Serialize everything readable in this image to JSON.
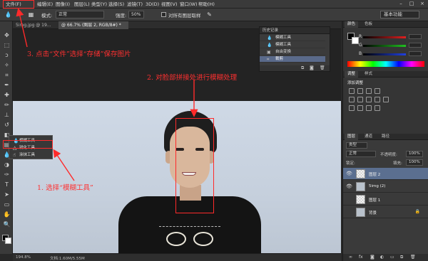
{
  "menubar": {
    "items": [
      "文件(F)",
      "编辑(E)",
      "图像(I)",
      "图层(L)",
      "类型(Y)",
      "选择(S)",
      "滤镜(T)",
      "3D(D)",
      "视图(V)",
      "窗口(W)",
      "帮助(H)"
    ],
    "window_controls": [
      "–",
      "□",
      "×"
    ]
  },
  "options": {
    "mode_label": "模式:",
    "mode_value": "正常",
    "strength_label": "强度:",
    "strength_value": "50%",
    "sample_all_label": "对所有图层取样",
    "workspace": "基本功能"
  },
  "doc_tabs": [
    {
      "label": "5img.jpg @ 19..."
    },
    {
      "label": "@ 66.7% (图层 2, RGB/8#) *"
    }
  ],
  "flyout": {
    "items": [
      {
        "icon": "blur-icon",
        "label": "模糊工具",
        "shortcut": ""
      },
      {
        "icon": "sharpen-icon",
        "label": "锐化工具",
        "shortcut": ""
      },
      {
        "icon": "smudge-icon",
        "label": "涂抹工具",
        "shortcut": ""
      }
    ]
  },
  "annotations": {
    "step1": "1. 选择“模糊工具”",
    "step2": "2. 对脸部拼接处进行模糊处理",
    "step3": "3. 点击“文件”选择“存储”保存图片"
  },
  "history": {
    "title": "历史记录",
    "items": [
      {
        "icon": "drop-icon",
        "label": "模糊工具"
      },
      {
        "icon": "drop-icon",
        "label": "模糊工具"
      },
      {
        "icon": "transform-icon",
        "label": "自由变换"
      },
      {
        "icon": "crop-icon",
        "label": "裁剪"
      }
    ]
  },
  "statusbar": {
    "zoom": "194.8%",
    "doc": "文档:1.60M/5.55M"
  },
  "dock": {
    "color_tabs": [
      "颜色",
      "色板"
    ],
    "slider_labels": [
      "R",
      "G",
      "B"
    ],
    "adjust_tabs": [
      "调整",
      "样式"
    ],
    "adjust_title": "添加调整",
    "layers_tabs": [
      "图层",
      "通道",
      "路径"
    ],
    "kind_label": "类型",
    "blend_mode": "正常",
    "opacity_label": "不透明度:",
    "opacity_value": "100%",
    "lock_label": "锁定:",
    "fill_label": "填充:",
    "fill_value": "100%",
    "layers": [
      {
        "name": "图层 2",
        "thumb": "checker",
        "selected": true
      },
      {
        "name": "5img (2)",
        "thumb": "photo",
        "selected": false
      },
      {
        "name": "图层 1",
        "thumb": "checker",
        "selected": false
      },
      {
        "name": "背景",
        "thumb": "photo",
        "selected": false,
        "locked": true
      }
    ],
    "colors": {
      "slider_r": "#e02020",
      "slider_g": "#20c020",
      "slider_b": "#2040e0"
    }
  }
}
